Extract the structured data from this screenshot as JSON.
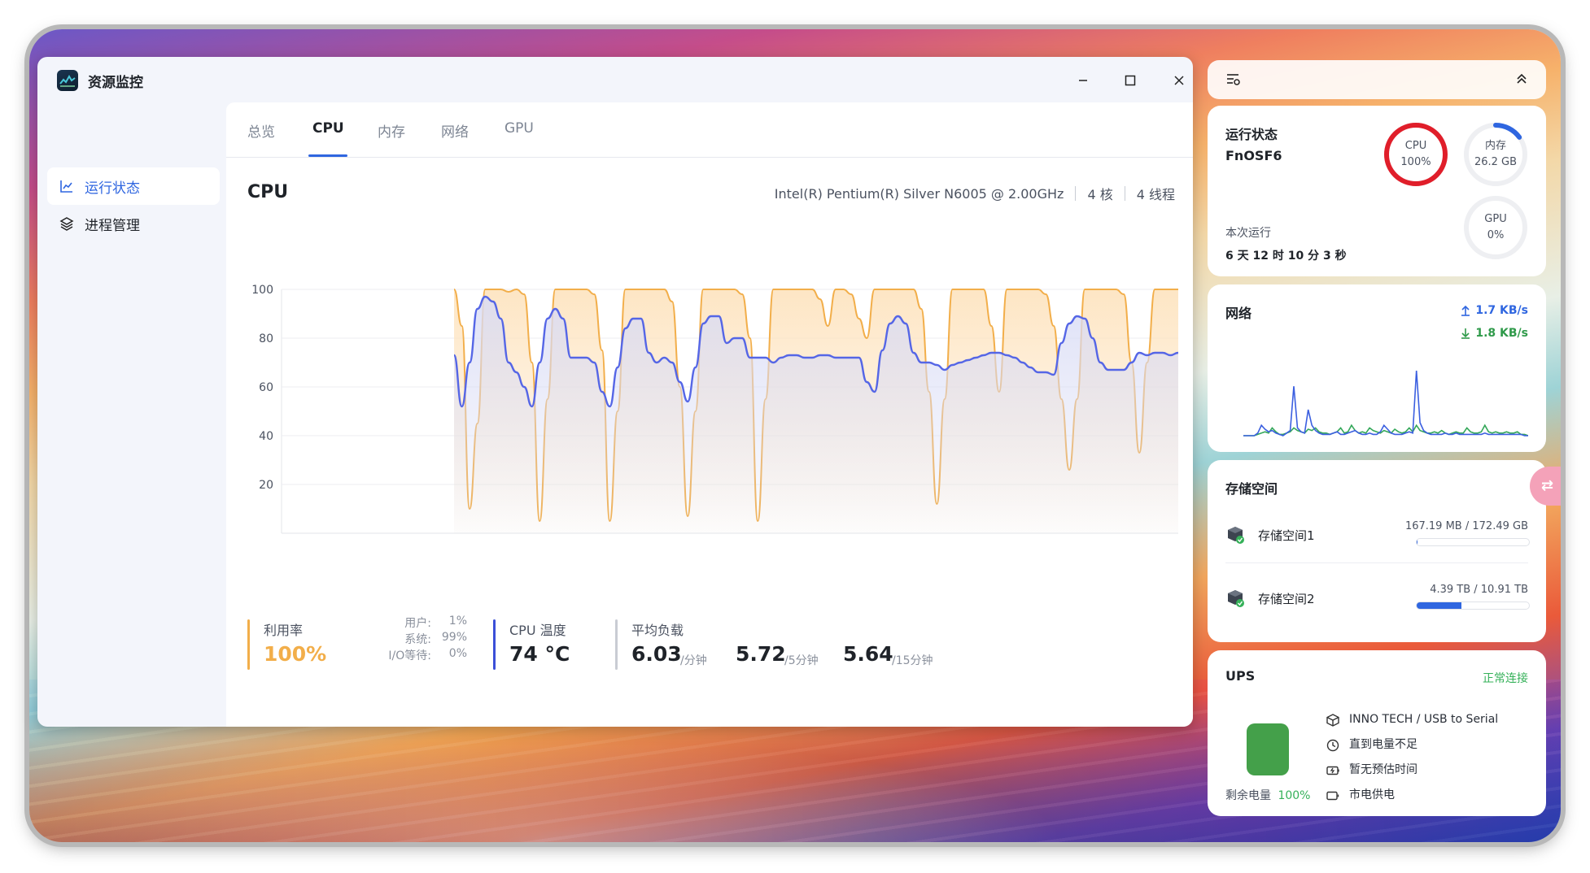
{
  "window": {
    "title": "资源监控"
  },
  "sidebar": {
    "items": [
      {
        "label": "运行状态",
        "icon": "line-chart-icon",
        "active": true
      },
      {
        "label": "进程管理",
        "icon": "layers-icon",
        "active": false
      }
    ]
  },
  "tabs": [
    {
      "label": "总览",
      "active": false
    },
    {
      "label": "CPU",
      "active": true
    },
    {
      "label": "内存",
      "active": false
    },
    {
      "label": "网络",
      "active": false
    },
    {
      "label": "GPU",
      "active": false
    }
  ],
  "cpu": {
    "heading": "CPU",
    "model": "Intel(R) Pentium(R) Silver N6005 @ 2.00GHz",
    "cores": "4 核",
    "threads": "4 线程"
  },
  "chart_data": {
    "type": "line",
    "ylim": [
      0,
      100
    ],
    "yticks": [
      100,
      80,
      60,
      40,
      20
    ],
    "grid": true,
    "series": [
      {
        "color": "#f2ae4a",
        "fill": "#fde3be",
        "values": [
          100,
          85,
          10,
          45,
          100,
          100,
          100,
          99,
          100,
          98,
          70,
          5,
          55,
          100,
          100,
          100,
          100,
          100,
          98,
          75,
          5,
          50,
          100,
          100,
          100,
          100,
          100,
          100,
          95,
          60,
          7,
          50,
          100,
          100,
          100,
          100,
          100,
          98,
          80,
          5,
          55,
          100,
          100,
          100,
          100,
          100,
          100,
          96,
          85,
          100,
          100,
          98,
          88,
          80,
          100,
          100,
          100,
          100,
          100,
          100,
          92,
          58,
          12,
          55,
          100,
          100,
          100,
          100,
          100,
          85,
          58,
          100,
          100,
          100,
          100,
          100,
          98,
          85,
          55,
          26,
          55,
          100,
          100,
          100,
          100,
          100,
          98,
          70,
          33,
          70,
          100,
          100,
          100,
          100
        ]
      },
      {
        "color": "#5566e6",
        "fill": "#d9dcf5",
        "values": [
          73,
          52,
          70,
          92,
          97,
          95,
          88,
          70,
          66,
          60,
          52,
          70,
          88,
          92,
          88,
          72,
          72,
          72,
          70,
          58,
          52,
          68,
          84,
          88,
          88,
          74,
          70,
          72,
          70,
          62,
          54,
          68,
          86,
          89,
          89,
          78,
          80,
          80,
          72,
          72,
          72,
          70,
          72,
          73,
          73,
          72,
          72,
          73,
          73,
          72,
          72,
          72,
          72,
          62,
          58,
          75,
          86,
          89,
          86,
          74,
          70,
          70,
          69,
          67,
          69,
          70,
          71,
          72,
          73,
          74,
          74,
          73,
          72,
          70,
          68,
          66,
          66,
          65,
          78,
          86,
          89,
          88,
          80,
          70,
          67,
          67,
          67,
          70,
          74,
          73,
          74,
          74,
          73,
          74
        ]
      }
    ]
  },
  "stats": {
    "util_label": "利用率",
    "util_value": "100%",
    "user_label": "用户:",
    "user_value": "1%",
    "system_label": "系统:",
    "system_value": "99%",
    "io_label": "I/O等待:",
    "io_value": "0%",
    "temp_label": "CPU 温度",
    "temp_value": "74 °C",
    "load_label": "平均负载",
    "load1": "6.03",
    "load1_unit": "/分钟",
    "load5": "5.72",
    "load5_unit": "/5分钟",
    "load15": "5.64",
    "load15_unit": "/15分钟"
  },
  "widgets": {
    "status": {
      "title": "运行状态",
      "host": "FnOSF6",
      "uptime_label": "本次运行",
      "uptime": "6 天 12 时 10 分 3 秒",
      "cpu": {
        "label": "CPU",
        "value": "100%",
        "fraction": 1.0,
        "color": "#e01e2a"
      },
      "mem": {
        "label": "内存",
        "value": "26.2 GB",
        "fraction": 0.15,
        "color": "#2f66e0"
      },
      "gpu": {
        "label": "GPU",
        "value": "0%",
        "fraction": 0.0
      }
    },
    "network": {
      "title": "网络",
      "up": "1.7 KB/s",
      "down": "1.8 KB/s",
      "up_series": [
        0,
        0,
        0,
        0,
        2,
        8,
        5,
        3,
        4,
        2,
        1,
        0,
        2,
        4,
        38,
        6,
        3,
        2,
        20,
        8,
        4,
        2,
        1,
        1,
        1,
        2,
        3,
        1,
        1,
        2,
        3,
        4,
        2,
        1,
        1,
        2,
        1,
        1,
        3,
        8,
        5,
        2,
        1,
        1,
        1,
        2,
        3,
        2,
        50,
        10,
        4,
        2,
        1,
        1,
        1,
        1,
        2,
        1,
        1,
        2,
        1,
        1,
        1,
        1,
        1,
        1,
        1,
        2,
        1,
        1,
        1,
        1,
        1,
        1,
        1,
        1,
        1,
        1,
        0,
        0
      ],
      "down_series": [
        0,
        0,
        0,
        0,
        1,
        2,
        3,
        2,
        6,
        3,
        1,
        1,
        2,
        3,
        6,
        4,
        3,
        2,
        5,
        4,
        6,
        3,
        2,
        2,
        1,
        2,
        3,
        6,
        2,
        3,
        8,
        4,
        2,
        3,
        2,
        6,
        4,
        3,
        2,
        4,
        3,
        2,
        5,
        3,
        2,
        3,
        6,
        3,
        8,
        4,
        3,
        2,
        2,
        3,
        2,
        4,
        2,
        1,
        2,
        3,
        2,
        2,
        6,
        3,
        2,
        2,
        3,
        8,
        3,
        2,
        3,
        2,
        2,
        3,
        2,
        2,
        3,
        1,
        1,
        0
      ]
    },
    "storage": {
      "title": "存储空间",
      "volumes": [
        {
          "name": "存储空间1",
          "used": "167.19 MB",
          "total": "172.49 GB",
          "fraction": 0.001
        },
        {
          "name": "存储空间2",
          "used": "4.39 TB",
          "total": "10.91 TB",
          "fraction": 0.4
        }
      ]
    },
    "ups": {
      "title": "UPS",
      "status": "正常连接",
      "battery_label": "剩余电量",
      "battery_value": "100%",
      "battery_fraction": 1.0,
      "details": [
        {
          "icon": "box-icon",
          "text": "INNO TECH / USB to Serial"
        },
        {
          "icon": "clock-icon",
          "text": "直到电量不足"
        },
        {
          "icon": "battery-charging-icon",
          "text": "暂无预估时间"
        },
        {
          "icon": "plug-icon",
          "text": "市电供电"
        }
      ]
    }
  }
}
